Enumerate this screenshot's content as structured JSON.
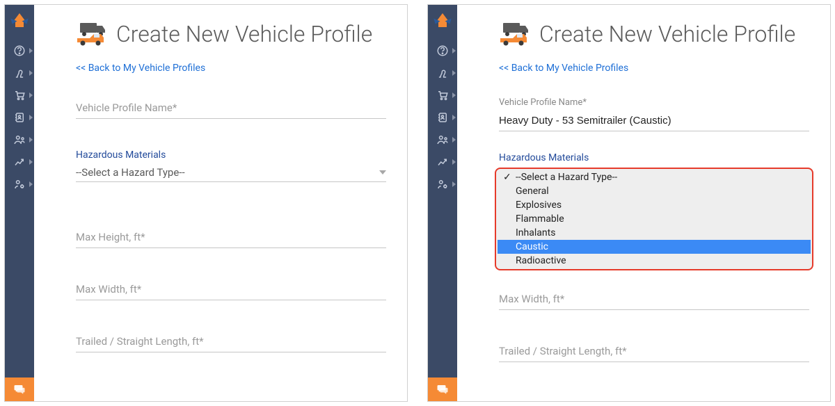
{
  "page_title": "Create New Vehicle Profile",
  "back_link": "<< Back to My Vehicle Profiles",
  "labels": {
    "profile_name": "Vehicle Profile Name*",
    "hazmat": "Hazardous Materials",
    "max_height": "Max Height, ft*",
    "max_width": "Max Width, ft*",
    "trailed_length": "Trailed / Straight Length, ft*"
  },
  "select": {
    "placeholder": "--Select a Hazard Type--",
    "options": [
      "--Select a Hazard Type--",
      "General",
      "Explosives",
      "Flammable",
      "Inhalants",
      "Caustic",
      "Radioactive"
    ],
    "highlighted_index": 5,
    "checked_index": 0
  },
  "right_panel": {
    "profile_name_value": "Heavy Duty - 53 Semitrailer (Caustic)"
  },
  "sidebar_items": [
    "help",
    "routes",
    "cart",
    "address-book",
    "drivers",
    "analytics",
    "settings"
  ]
}
